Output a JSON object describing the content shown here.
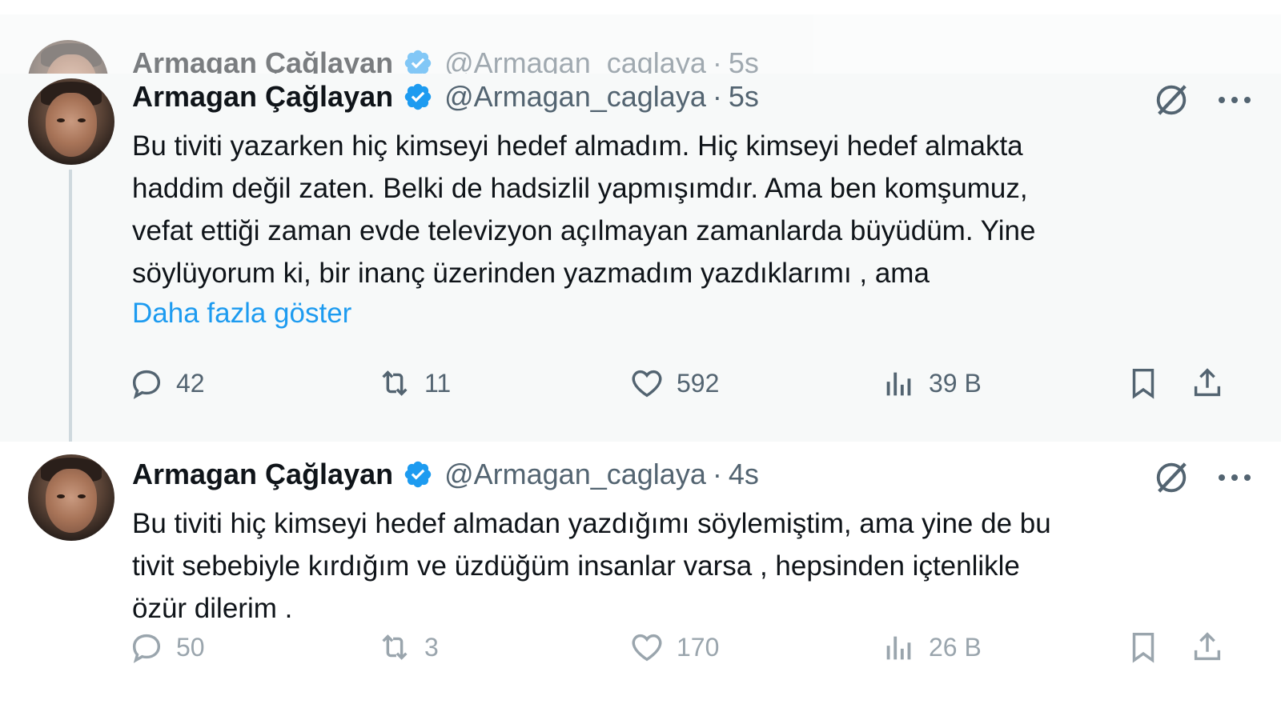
{
  "ghost_tweet": {
    "name": "Armagan Çağlayan",
    "handle": "@Armagan_caglaya",
    "separator": "·",
    "time": "5s"
  },
  "tweets": [
    {
      "name": "Armagan Çağlayan",
      "handle": "@Armagan_caglaya",
      "separator": "·",
      "time": "5s",
      "text_lines": [
        "Bu tiviti yazarken hiç kimseyi hedef almadım. Hiç kimseyi hedef almakta",
        "haddim değil zaten. Belki de hadsizlil yapmışımdır. Ama ben komşumuz,",
        "vefat ettiği zaman evde televizyon açılmayan zamanlarda büyüdüm. Yine",
        "söylüyorum ki, bir inanç üzerinden yazmadım yazdıklarımı , ama"
      ],
      "show_more": "Daha fazla göster",
      "replies": "42",
      "reposts": "11",
      "likes": "592",
      "views": "39 B"
    },
    {
      "name": "Armagan Çağlayan",
      "handle": "@Armagan_caglaya",
      "separator": "·",
      "time": "4s",
      "text_lines": [
        "Bu tiviti hiç kimseyi hedef almadan yazdığımı söylemiştim, ama yine de bu",
        "tivit sebebiyle kırdığım ve üzdüğüm insanlar varsa , hepsinden içtenlikle",
        "özür dilerim ."
      ],
      "replies": "50",
      "reposts": "3",
      "likes": "170",
      "views": "26 B"
    }
  ],
  "colors": {
    "accent": "#1d9bf0",
    "muted": "#536471",
    "text": "#0f1419",
    "highlight_bg": "#f7f9f9"
  },
  "icons": [
    "verified-badge-icon",
    "grok-icon",
    "more-icon",
    "reply-icon",
    "repost-icon",
    "like-icon",
    "views-icon",
    "bookmark-icon",
    "share-icon"
  ]
}
